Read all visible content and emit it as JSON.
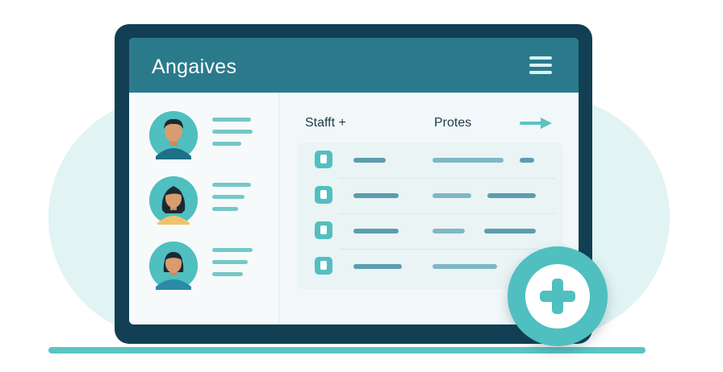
{
  "app": {
    "title": "Angaives"
  },
  "header": {
    "menu_icon": "hamburger-menu-icon"
  },
  "sidebar": {
    "contacts": [
      {
        "avatar": "man-avatar"
      },
      {
        "avatar": "woman-avatar"
      },
      {
        "avatar": "woman-avatar"
      }
    ]
  },
  "main": {
    "staff_label": "Stafft +",
    "protes_label": "Protes",
    "arrow_icon": "arrow-right-icon",
    "rows": [
      {
        "icon": "document-icon"
      },
      {
        "icon": "document-icon"
      },
      {
        "icon": "document-icon"
      },
      {
        "icon": "document-icon"
      }
    ]
  },
  "fab": {
    "icon": "plus-icon"
  },
  "colors": {
    "frame": "#123f54",
    "header": "#2a7a8c",
    "accent": "#4fbfc0",
    "background": "#e1f3f3"
  }
}
